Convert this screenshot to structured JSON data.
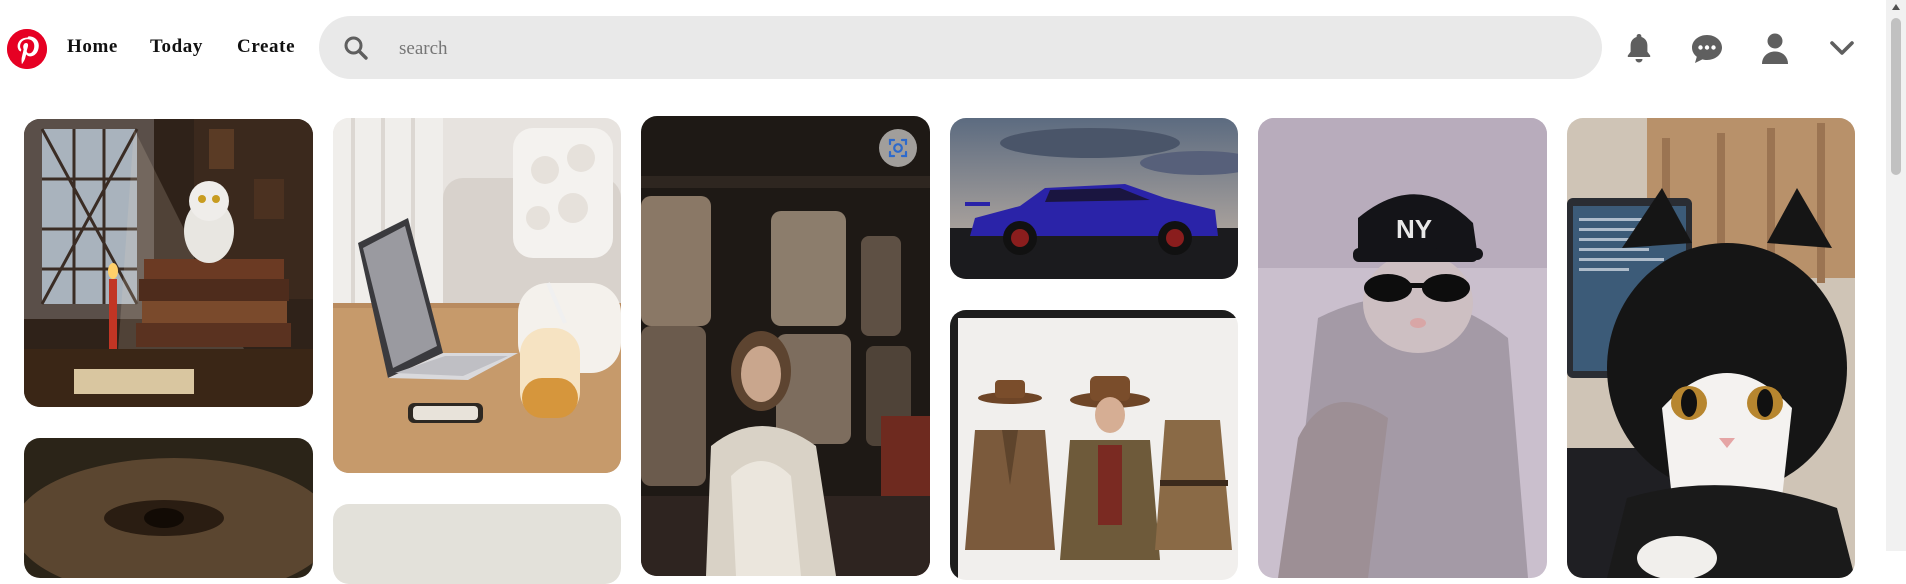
{
  "nav": {
    "logo_icon": "pinterest-logo-icon",
    "brand_color": "#e60023",
    "links": [
      "Home",
      "Today",
      "Create"
    ]
  },
  "search": {
    "placeholder": "search",
    "value": "",
    "icon": "search-icon"
  },
  "header_icons": [
    "bell-icon",
    "chat-icon",
    "profile-icon",
    "chevron-down-icon"
  ],
  "pins": [
    {
      "subject": "snowy owl on stacked books by leaded window with candles"
    },
    {
      "subject": "laptop on wooden table beside cushioned sofa and latte glass"
    },
    {
      "subject": "painted girl sitting in train carriage by windows"
    },
    {
      "subject": "blue sports car at dusk"
    },
    {
      "subject": "woman in brown hat and coat beside hanging jackets"
    },
    {
      "subject": "cat wearing sunglasses and NY baseball cap"
    },
    {
      "subject": "black and white cat with bob haircut at desk"
    },
    {
      "subject": "close-up portrait crop"
    },
    {
      "subject": "light neutral image crop"
    }
  ],
  "visual_search_icon": "visual-search-icon"
}
